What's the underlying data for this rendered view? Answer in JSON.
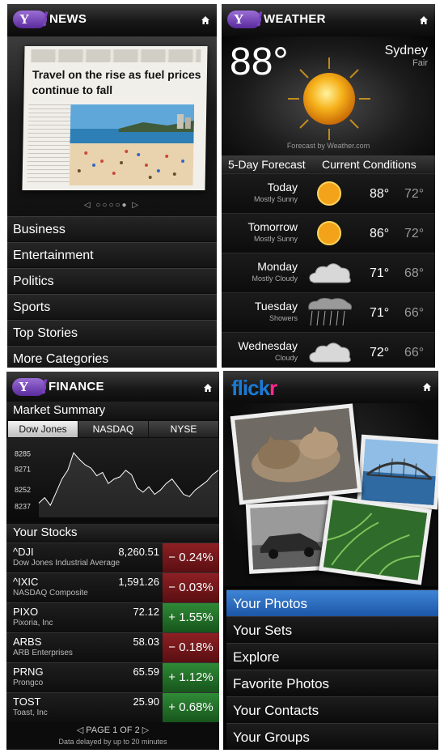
{
  "news": {
    "brand": "Y!",
    "title": "NEWS",
    "headline": "Travel on the rise as fuel prices continue to fall",
    "pager": "◁ ○○○○● ▷",
    "categories": [
      "Business",
      "Entertainment",
      "Politics",
      "Sports",
      "Top Stories",
      "More Categories"
    ]
  },
  "weather": {
    "brand": "Y!",
    "title": "WEATHER",
    "current_temp": "88°",
    "city": "Sydney",
    "condition": "Fair",
    "credit": "Forecast by Weather.com",
    "tabs": [
      "5-Day Forecast",
      "Current Conditions"
    ],
    "forecast": [
      {
        "day": "Today",
        "cond": "Mostly Sunny",
        "hi": "88°",
        "lo": "72°",
        "icon": "sun-icon"
      },
      {
        "day": "Tomorrow",
        "cond": "Mostly Sunny",
        "hi": "86°",
        "lo": "72°",
        "icon": "sun-icon"
      },
      {
        "day": "Monday",
        "cond": "Mostly Cloudy",
        "hi": "71°",
        "lo": "68°",
        "icon": "cloud-icon"
      },
      {
        "day": "Tuesday",
        "cond": "Showers",
        "hi": "71°",
        "lo": "66°",
        "icon": "rain-cloud-icon"
      },
      {
        "day": "Wednesday",
        "cond": "Cloudy",
        "hi": "72°",
        "lo": "66°",
        "icon": "cloud-icon"
      }
    ]
  },
  "finance": {
    "brand": "Y!",
    "title": "FINANCE",
    "market_summary": "Market Summary",
    "tabs": [
      "Dow Jones",
      "NASDAQ",
      "NYSE"
    ],
    "chart_data": {
      "type": "line",
      "y_ticks": [
        "8285",
        "8271",
        "8252",
        "8237"
      ],
      "values": [
        8240,
        8245,
        8238,
        8250,
        8262,
        8270,
        8286,
        8280,
        8275,
        8272,
        8265,
        8268,
        8258,
        8262,
        8264,
        8270,
        8266,
        8254,
        8250,
        8255,
        8248,
        8252,
        8258,
        8262,
        8255,
        8248,
        8246,
        8252,
        8256,
        8260,
        8266,
        8270
      ]
    },
    "your_stocks": "Your Stocks",
    "stocks": [
      {
        "symbol": "^DJI",
        "name": "Dow Jones Industrial Average",
        "price": "8,260.51",
        "change": "− 0.24%",
        "dir": "down"
      },
      {
        "symbol": "^IXIC",
        "name": "NASDAQ Composite",
        "price": "1,591.26",
        "change": "− 0.03%",
        "dir": "down"
      },
      {
        "symbol": "PIXO",
        "name": "Pixoria, Inc",
        "price": "72.12",
        "change": "+ 1.55%",
        "dir": "up"
      },
      {
        "symbol": "ARBS",
        "name": "ARB Enterprises",
        "price": "58.03",
        "change": "− 0.18%",
        "dir": "down"
      },
      {
        "symbol": "PRNG",
        "name": "Prongco",
        "price": "65.59",
        "change": "+ 1.12%",
        "dir": "up"
      },
      {
        "symbol": "TOST",
        "name": "Toast, Inc",
        "price": "25.90",
        "change": "+ 0.68%",
        "dir": "up"
      }
    ],
    "pager": "◁  PAGE 1 OF 2  ▷",
    "note": "Data delayed by up to 20 minutes"
  },
  "flickr": {
    "logo_part1": "flick",
    "logo_part2": "r",
    "menu": [
      "Your Photos",
      "Your Sets",
      "Explore",
      "Favorite Photos",
      "Your Contacts",
      "Your Groups"
    ]
  },
  "colors": {
    "accent_purple": "#7d3fc0",
    "up_green": "#2f8a36",
    "down_red": "#8d2024",
    "flickr_blue": "#1a7ad6",
    "flickr_pink": "#ff2a8e",
    "selected_blue": "#3f85d6"
  }
}
